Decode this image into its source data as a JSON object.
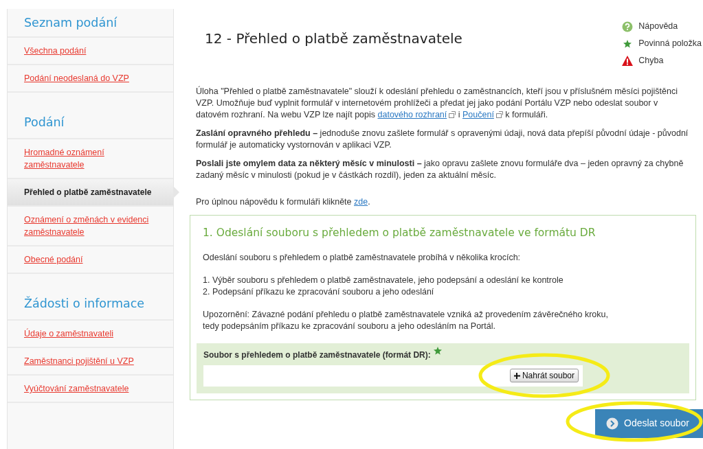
{
  "sidebar": {
    "sections": [
      {
        "heading": "Seznam podání",
        "items": [
          {
            "label": "Všechna podání",
            "selected": false
          },
          {
            "label": "Podání neodeslaná do VZP",
            "selected": false
          }
        ]
      },
      {
        "heading": "Podání",
        "items": [
          {
            "label": "Hromadné oznámení zaměstnavatele",
            "selected": false
          },
          {
            "label": "Přehled o platbě zaměstnavatele",
            "selected": true
          },
          {
            "label": "Oznámení o změnách v evidenci zaměstnavatele",
            "selected": false
          },
          {
            "label": "Obecné podání",
            "selected": false
          }
        ]
      },
      {
        "heading": "Žádosti o informace",
        "items": [
          {
            "label": "Údaje o zaměstnavateli",
            "selected": false
          },
          {
            "label": "Zaměstnanci pojištění u VZP",
            "selected": false
          },
          {
            "label": "Vyúčtování zaměstnavatele",
            "selected": false
          }
        ]
      }
    ]
  },
  "title": "12 - Přehled o platbě zaměstnavatele",
  "legend": [
    {
      "kind": "help",
      "label": "Nápověda"
    },
    {
      "kind": "required",
      "label": "Povinná položka"
    },
    {
      "kind": "error",
      "label": "Chyba"
    }
  ],
  "paragraphs": [
    [
      {
        "kind": "text",
        "text": "Úloha \"Přehled o platbě zaměstnavatele\" slouží k odeslání přehledu o zaměstnancích, kteří jsou v příslušném měsíci pojištěnci VZP. Umožňuje buď vyplnit formulář v internetovém prohlížeči a předat jej jako podání Portálu VZP nebo odeslat soubor v datovém rozhraní. Na webu VZP lze najít popis "
      },
      {
        "kind": "link",
        "text": "datového rozhraní",
        "external": true
      },
      {
        "kind": "text",
        "text": " i "
      },
      {
        "kind": "link",
        "text": "Poučení",
        "external": true
      },
      {
        "kind": "text",
        "text": " k formuláři."
      }
    ],
    [
      {
        "kind": "text",
        "text": "**Zaslání opravného přehledu –** jednoduše znovu zašlete formulář s opravenými údaji, nová data přepíší původní údaje - původní formulář je automaticky vystornován v aplikaci VZP."
      }
    ],
    [
      {
        "kind": "text",
        "text": "**Poslali jste omylem data za některý měsíc v minulosti –** jako opravu zašlete znovu formuláře dva – jeden opravný za chybně zadaný měsíc v minulosti (pokud je v částkách rozdíl), jeden za aktuální měsíc."
      }
    ],
    [
      {
        "kind": "text",
        "text": "Pro úplnou nápovědu k formuláři klikněte "
      },
      {
        "kind": "link",
        "text": "zde",
        "external": false
      },
      {
        "kind": "text",
        "text": "."
      }
    ]
  ],
  "section": {
    "title": "1. Odeslání souboru s přehledem o platbě zaměstnavatele ve formátu DR",
    "intro": "Odeslání souboru s přehledem o platbě zaměstnavatele probíhá v několika krocích:",
    "steps": [
      "1. Výběr souboru s přehledem o platbě zaměstnavatele, jeho podepsání a odeslání ke kontrole",
      "2. Podepsání příkazu ke zpracování souboru a jeho odeslání"
    ],
    "warning": [
      "Upozornění: Závazné podání přehledu o platbě zaměstnavatele vzniká až provedením závěrečného kroku,",
      "tedy podepsáním příkazu ke zpracování souboru a jeho odesláním na Portál."
    ],
    "upload": {
      "label": "Soubor s přehledem o platbě zaměstnavatele (formát DR):",
      "required": true,
      "button": "Nahrát soubor",
      "highlighted": true
    }
  },
  "submit": {
    "label": "Odeslat soubor",
    "highlighted": true
  }
}
